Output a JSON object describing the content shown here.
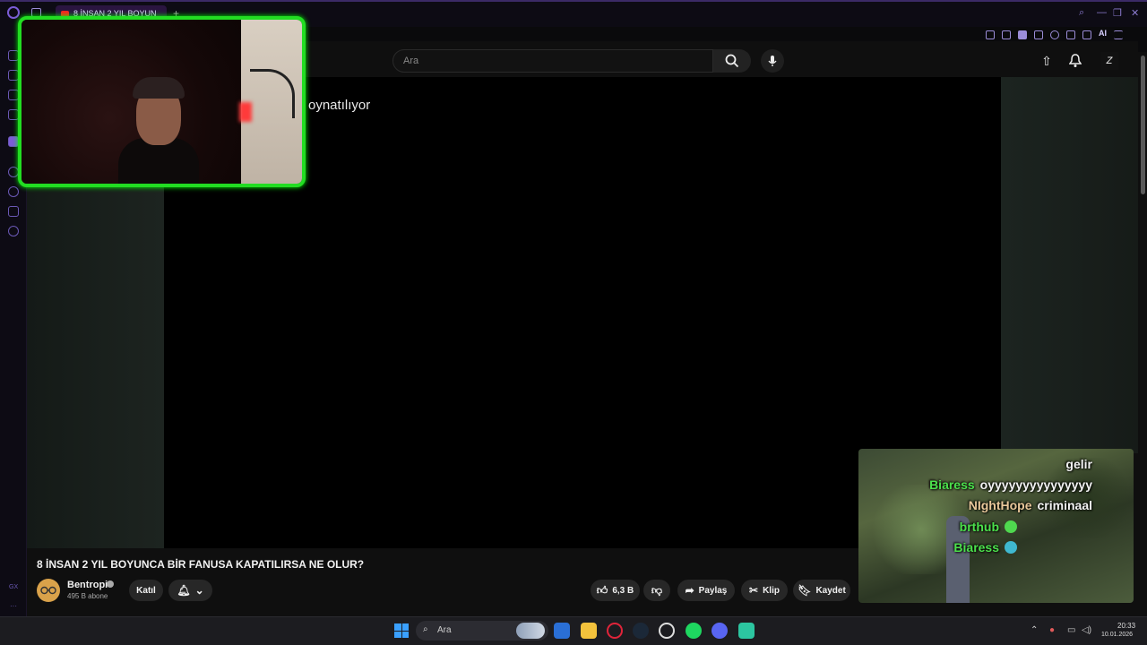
{
  "browser": {
    "tab_title": "8 İNSAN 2 YIL BOYUN",
    "new_tab": "+",
    "toolbar_ai": "AI"
  },
  "youtube": {
    "search_placeholder": "Ara",
    "overlay_text": "oynatılıyor",
    "video_title": "8 İNSAN 2 YIL BOYUNCA BİR FANUSA KAPATILIRSA NE OLUR?",
    "channel": {
      "name": "Bentropi",
      "subscribers": "495 B abone"
    },
    "join_label": "Katıl",
    "likes": "6,3 B",
    "share_label": "Paylaş",
    "clip_label": "Klip",
    "save_label": "Kaydet"
  },
  "chat": {
    "messages": [
      {
        "user": "",
        "text": "gelir",
        "user_color": "#4ce04c"
      },
      {
        "user": "Biaress",
        "text": "oyyyyyyyyyyyyyyy",
        "user_color": "#4ce04c"
      },
      {
        "user": "NIghtHope",
        "text": "criminaal",
        "user_color": "#e8c79a"
      },
      {
        "user": "brthub",
        "text": "",
        "user_color": "#4ce04c"
      },
      {
        "user": "Biaress",
        "text": "",
        "user_color": "#4ce04c"
      }
    ]
  },
  "taskbar": {
    "search_label": "Ara",
    "time": "20:33",
    "date": "10.01.2026"
  },
  "colors": {
    "webcam_border": "#22dd22",
    "accent": "#7b5cd6"
  }
}
